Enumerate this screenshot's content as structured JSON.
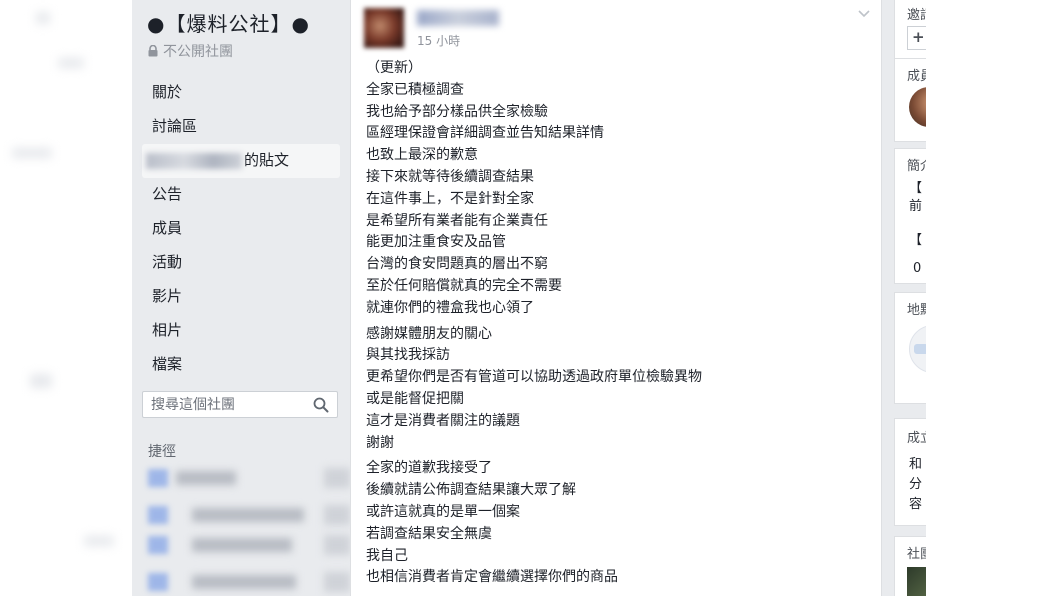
{
  "sidebar": {
    "group_name": "●【爆料公社】●",
    "privacy_label": "不公開社團",
    "nav": [
      {
        "label": "關於"
      },
      {
        "label": "討論區"
      },
      {
        "label": "的貼文",
        "active": true
      },
      {
        "label": "公告"
      },
      {
        "label": "成員"
      },
      {
        "label": "活動"
      },
      {
        "label": "影片"
      },
      {
        "label": "相片"
      },
      {
        "label": "檔案"
      }
    ],
    "search_placeholder": "搜尋這個社團",
    "shortcuts_title": "捷徑"
  },
  "post": {
    "time": "15 小時",
    "paragraphs": [
      [
        "（更新）",
        "全家已積極調查",
        "我也給予部分樣品供全家檢驗",
        "區經理保證會詳細調查並告知結果詳情",
        "也致上最深的歉意",
        "接下來就等待後續調查結果",
        "在這件事上，不是針對全家",
        "是希望所有業者能有企業責任",
        "能更加注重食安及品管",
        "台灣的食安問題真的層出不窮",
        "至於任何賠償就真的完全不需要",
        "就連你們的禮盒我也心領了"
      ],
      [
        "感謝媒體朋友的關心",
        "與其找我採訪",
        "更希望你們是否有管道可以協助透過政府單位檢驗異物",
        "或是能督促把關",
        "這才是消費者關注的議題",
        "謝謝"
      ],
      [
        "全家的道歉我接受了",
        "後續就請公佈調查結果讓大眾了解",
        "或許這就真的是單一個案",
        "若調查結果安全無虞",
        "我自己",
        "也相信消費者肯定會繼續選擇你們的商品"
      ]
    ]
  },
  "right": {
    "invite_label": "邀請",
    "add_symbol": "+",
    "members_label": "成員",
    "description_label": "簡介",
    "desc_line1": "【",
    "desc_line2": "前",
    "desc_line3": "【",
    "desc_count": "0",
    "location_label": "地點",
    "card4_label": "成立",
    "card4_line1": "和",
    "card4_line2": "分",
    "card4_line3": "容",
    "card5_label": "社團"
  }
}
